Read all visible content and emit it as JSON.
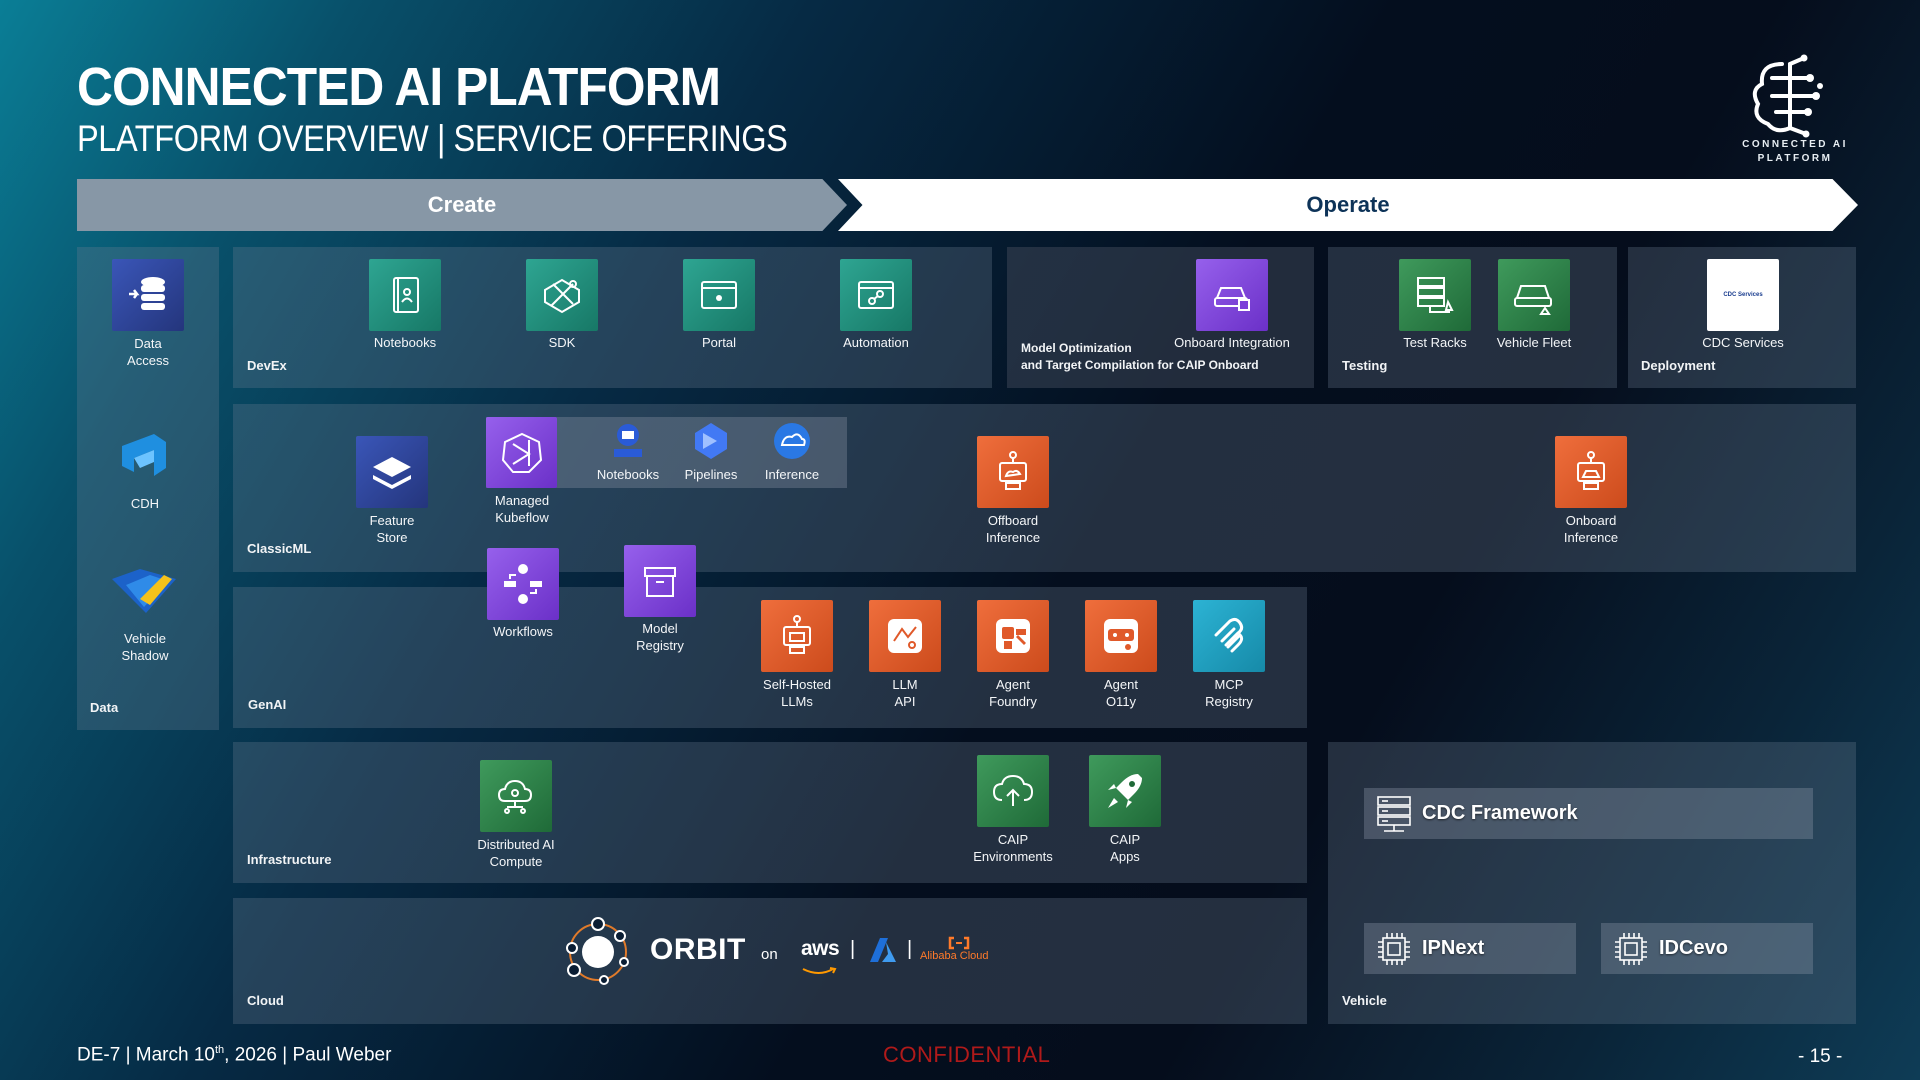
{
  "header": {
    "title": "CONNECTED AI PLATFORM",
    "subtitle": "PLATFORM OVERVIEW | SERVICE OFFERINGS",
    "logo_text_line1": "CONNECTED AI",
    "logo_text_line2": "PLATFORM"
  },
  "phases": {
    "create": "Create",
    "operate": "Operate"
  },
  "sections": {
    "data": "Data",
    "devex": "DevEx",
    "classicml": "ClassicML",
    "genai": "GenAI",
    "infrastructure": "Infrastructure",
    "cloud": "Cloud",
    "model_opt": "Model Optimization\nand Target Compilation for CAIP Onboard",
    "testing": "Testing",
    "deployment": "Deployment",
    "vehicle": "Vehicle"
  },
  "data_items": {
    "data_access": "Data\nAccess",
    "cdh": "CDH",
    "vehicle_shadow": "Vehicle\nShadow"
  },
  "devex_items": {
    "notebooks": "Notebooks",
    "sdk": "SDK",
    "portal": "Portal",
    "automation": "Automation"
  },
  "operate_items": {
    "onboard_integration": "Onboard Integration",
    "test_racks": "Test Racks",
    "vehicle_fleet": "Vehicle Fleet",
    "cdc_services": "CDC Services",
    "cdc_services_tile": "CDC Services"
  },
  "classicml_items": {
    "feature_store": "Feature\nStore",
    "managed_kubeflow": "Managed\nKubeflow",
    "kf_notebooks": "Notebooks",
    "kf_pipelines": "Pipelines",
    "kf_inference": "Inference",
    "workflows": "Workflows",
    "model_registry": "Model\nRegistry",
    "offboard_inference": "Offboard\nInference",
    "onboard_inference": "Onboard\nInference"
  },
  "genai_items": {
    "self_hosted_llms": "Self-Hosted\nLLMs",
    "llm_api": "LLM\nAPI",
    "agent_foundry": "Agent\nFoundry",
    "agent_o11y": "Agent\nO11y",
    "mcp_registry": "MCP\nRegistry"
  },
  "infra_items": {
    "distributed_ai_compute": "Distributed AI\nCompute",
    "caip_environments": "CAIP\nEnvironments",
    "caip_apps": "CAIP\nApps"
  },
  "cloud_items": {
    "orbit": "ORBIT",
    "on": "on",
    "aws": "aws",
    "separator": "|",
    "alibaba": "Alibaba Cloud"
  },
  "vehicle_items": {
    "cdc_framework": "CDC Framework",
    "ipnext": "IPNext",
    "idcevo": "IDCevo"
  },
  "footer": {
    "prefix": "DE-7 | March 10",
    "sup": "th",
    "suffix": ", 2026 | Paul Weber",
    "confidential": "CONFIDENTIAL",
    "page": "- 15 -"
  },
  "colors": {
    "accent_navy": "#0d3358",
    "orange": "#e0592a",
    "purple": "#7b3fd8",
    "teal": "#1f8c7a",
    "confidential_red": "#b01a1a"
  }
}
